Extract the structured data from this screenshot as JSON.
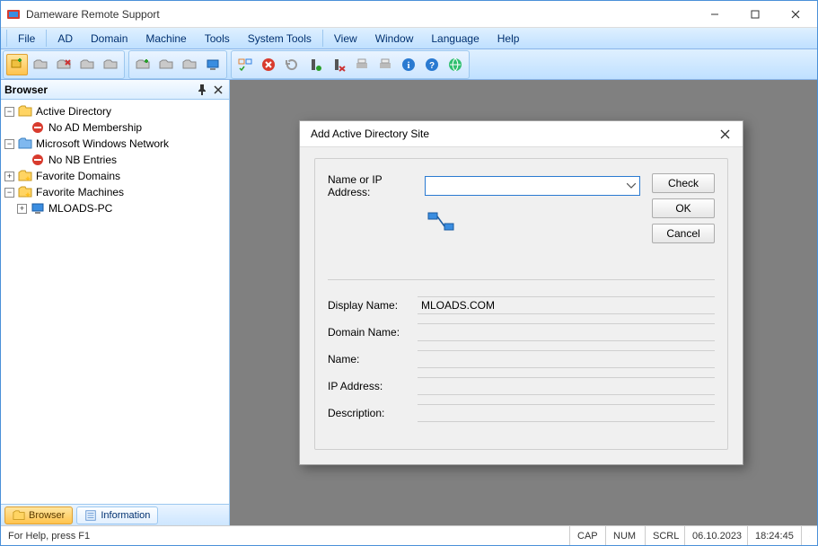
{
  "app": {
    "title": "Dameware Remote Support"
  },
  "menu": {
    "file": "File",
    "ad": "AD",
    "domain": "Domain",
    "machine": "Machine",
    "tools": "Tools",
    "system_tools": "System Tools",
    "view": "View",
    "window": "Window",
    "language": "Language",
    "help": "Help"
  },
  "browser": {
    "title": "Browser",
    "tabs": {
      "browser": "Browser",
      "information": "Information"
    },
    "tree": {
      "ad": "Active Directory",
      "ad_no_membership": "No AD Membership",
      "mwn": "Microsoft Windows Network",
      "no_nb": "No NB Entries",
      "fav_domains": "Favorite Domains",
      "fav_machines": "Favorite Machines",
      "machine1": "MLOADS-PC"
    }
  },
  "dialog": {
    "title": "Add Active Directory Site",
    "label_name_or_ip": "Name or IP Address:",
    "name_or_ip_value": "",
    "btn_check": "Check",
    "btn_ok": "OK",
    "btn_cancel": "Cancel",
    "label_display_name": "Display Name:",
    "display_name": "MLOADS.COM",
    "label_domain_name": "Domain Name:",
    "domain_name": "",
    "label_name": "Name:",
    "name": "",
    "label_ip": "IP Address:",
    "ip": "",
    "label_description": "Description:",
    "description": ""
  },
  "status": {
    "help": "For Help, press F1",
    "cap": "CAP",
    "num": "NUM",
    "scrl": "SCRL",
    "date": "06.10.2023",
    "time": "18:24:45"
  }
}
